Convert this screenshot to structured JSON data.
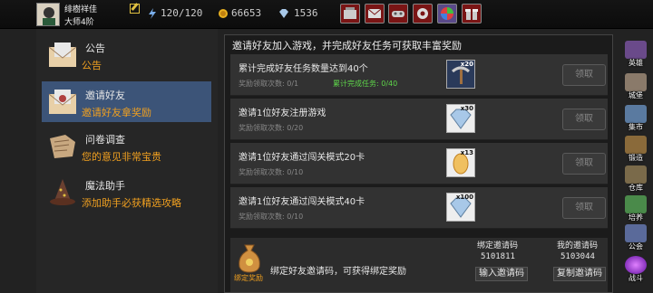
{
  "player": {
    "name": "绯樹祥佳",
    "rank": "大师4阶"
  },
  "stats": {
    "energy": "120/120",
    "gold": "66653",
    "gems": "1536"
  },
  "top_buttons": [
    "shop-icon",
    "mail-icon",
    "gamepad-icon",
    "gear-icon",
    "lucky-wheel-icon",
    "gift-icon"
  ],
  "menu": [
    {
      "title": "公告",
      "sub": "公告",
      "icon": "announcement-icon",
      "active": false
    },
    {
      "title": "邀请好友",
      "sub": "邀请好友拿奖励",
      "icon": "invite-icon",
      "active": true
    },
    {
      "title": "问卷调查",
      "sub": "您的意见非常宝贵",
      "icon": "survey-icon",
      "active": false
    },
    {
      "title": "魔法助手",
      "sub": "添加助手必获精选攻略",
      "icon": "wizard-hat-icon",
      "active": false
    }
  ],
  "main": {
    "title": "邀请好友加入游戏，并完成好友任务可获取丰富奖励",
    "tasks": [
      {
        "title": "累计完成好友任务数量达到40个",
        "count": "奖励领取次数: 0/1",
        "progress": "累计完成任务: 0/40",
        "reward_qty": "x20",
        "reward_icon": "pickaxe-icon",
        "claim": "领取"
      },
      {
        "title": "邀请1位好友注册游戏",
        "count": "奖励领取次数: 0/20",
        "progress": "",
        "reward_qty": "x30",
        "reward_icon": "diamond-icon",
        "claim": "领取"
      },
      {
        "title": "邀请1位好友通过闯关模式20卡",
        "count": "奖励领取次数: 0/10",
        "progress": "",
        "reward_qty": "x13",
        "reward_icon": "egg-icon",
        "claim": "领取"
      },
      {
        "title": "邀请1位好友通过闯关模式40卡",
        "count": "奖励领取次数: 0/10",
        "progress": "",
        "reward_qty": "x100",
        "reward_icon": "diamond-icon",
        "claim": "领取"
      }
    ],
    "bind": {
      "label": "绑定奖励",
      "text": "绑定好友邀请码，可获得绑定奖励",
      "bind_code_label": "绑定邀请码",
      "bind_code": "5101811",
      "bind_button": "输入邀请码",
      "my_code_label": "我的邀请码",
      "my_code": "5103044",
      "copy_button": "复制邀请码"
    }
  },
  "sidebar": [
    {
      "label": "英雄",
      "icon": "hero-icon",
      "color": "#6a4a8a"
    },
    {
      "label": "城堡",
      "icon": "castle-icon",
      "color": "#8a7a6a"
    },
    {
      "label": "集市",
      "icon": "market-icon",
      "color": "#5a7aa0"
    },
    {
      "label": "锻造",
      "icon": "anvil-icon",
      "color": "#8a6a3a"
    },
    {
      "label": "仓库",
      "icon": "storage-icon",
      "color": "#7a6a4a"
    },
    {
      "label": "培养",
      "icon": "train-icon",
      "color": "#4a8a4a"
    },
    {
      "label": "公会",
      "icon": "guild-icon",
      "color": "#5a6a9a"
    },
    {
      "label": "战斗",
      "icon": "battle-portal-icon",
      "color": "#8a30c0"
    }
  ]
}
